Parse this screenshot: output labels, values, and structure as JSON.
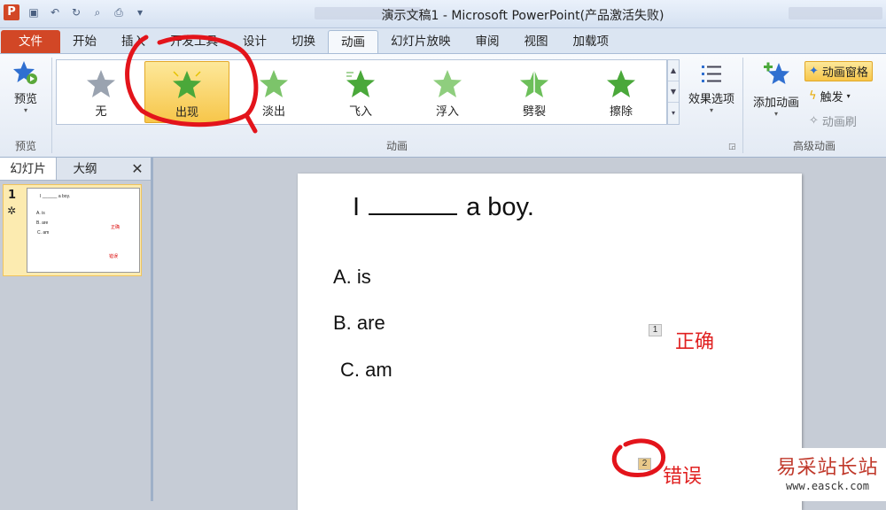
{
  "app": {
    "title": "演示文稿1 - Microsoft PowerPoint(产品激活失败)",
    "icon": "P"
  },
  "tabs": [
    "文件",
    "开始",
    "插入",
    "开发工具",
    "设计",
    "切换",
    "动画",
    "幻灯片放映",
    "审阅",
    "视图",
    "加载项"
  ],
  "ribbon": {
    "preview": {
      "label": "预览",
      "group": "预览"
    },
    "gallery": {
      "items": [
        "无",
        "出现",
        "淡出",
        "飞入",
        "浮入",
        "劈裂",
        "擦除"
      ],
      "selected": "出现",
      "group": "动画"
    },
    "effects": {
      "label": "效果选项"
    },
    "advanced": {
      "add": "添加动画",
      "pane": "动画窗格",
      "trigger": "触发",
      "painter": "动画刷",
      "group": "高级动画"
    }
  },
  "left_pane": {
    "tab_slides": "幻灯片",
    "tab_outline": "大纲",
    "close": "✕",
    "slide_number": "1",
    "slide_star": "✲",
    "thumb": {
      "title": "I ______ a boy.",
      "a": "A. is",
      "b": "B. are",
      "c": "C. am",
      "correct": "正确",
      "wrong": "错误"
    }
  },
  "slide": {
    "title_word1": "I",
    "title_word2": "a boy.",
    "option_a": "A.  is",
    "option_b": "B.  are",
    "option_c": "C.  am",
    "tag1": "1",
    "correct": "正确",
    "tag2": "2",
    "wrong": "错误"
  },
  "watermark": {
    "line1": "易采站长站",
    "line2": "www.easck.com"
  },
  "colors": {
    "file_tab": "#d24726",
    "star_green": "#4aa83a",
    "selected_item": "#f7c64a",
    "annotation_red": "#e02020"
  }
}
